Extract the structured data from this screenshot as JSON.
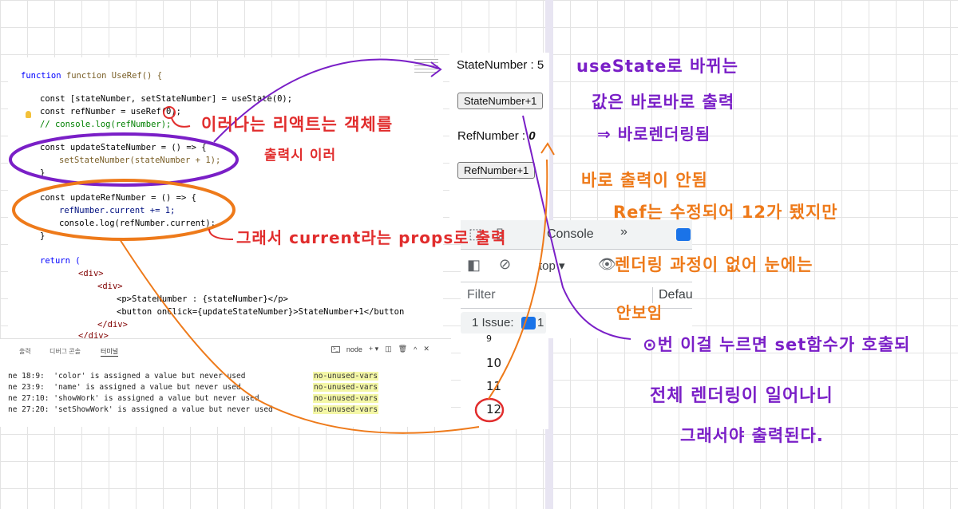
{
  "code": {
    "lines": [
      "function UseRef() {",
      "const [stateNumber, setStateNumber] = useState(0);",
      "const refNumber = useRef(0);",
      "// console.log(refNumber);",
      "const updateStateNumber = () => {",
      "setStateNumber(stateNumber + 1);",
      "}",
      "const updateRefNumber = () => {",
      "refNumber.current += 1;",
      "console.log(refNumber.current);",
      "}",
      "return (",
      "<div>",
      "<div>",
      "<p>StateNumber : {stateNumber}</p>",
      "<button onClick={updateStateNumber}>StateNumber+1</button",
      "</div>",
      "</div>"
    ]
  },
  "terminal": {
    "tabs": [
      "출력",
      "디버그 콘솔",
      "터미널"
    ],
    "active_tab": "터미널",
    "shell": "node",
    "lint_lines": [
      {
        "loc": "ne 18:9:",
        "msg": "'color' is assigned a value but never used",
        "rule": "no-unused-vars"
      },
      {
        "loc": "ne 23:9:",
        "msg": "'name' is assigned a value but never used",
        "rule": "no-unused-vars"
      },
      {
        "loc": "ne 27:10:",
        "msg": "'showWork' is assigned a value but never used",
        "rule": "no-unused-vars"
      },
      {
        "loc": "ne 27:20:",
        "msg": "'setShowWork' is assigned a value but never used",
        "rule": "no-unused-vars"
      }
    ]
  },
  "preview": {
    "state_label": "StateNumber : 5",
    "state_button": "StateNumber+1",
    "ref_label": "RefNumber : ",
    "ref_value": "0",
    "ref_button": "RefNumber+1"
  },
  "devtools": {
    "tab_console": "Console",
    "more_tabs": "»",
    "context": "top",
    "filter_placeholder": "Filter",
    "levels": "Defau",
    "issues_label": "1 Issue:",
    "issues_count": "1"
  },
  "console_output": [
    "9",
    "10",
    "11",
    "12"
  ],
  "annotations": {
    "red_1": "이러나는 리액트는 객체를",
    "red_2": "출력시 이러",
    "red_3": "그래서  current라는 props로 출력",
    "orange_1": "바로 출력이 안됨",
    "orange_2": "Ref는 수정되어 12가 됐지만",
    "orange_3": "렌더링 과정이 없어 눈에는",
    "orange_4": "안보임",
    "purple_1": "useState로 바뀌는",
    "purple_2": "값은 바로바로 출력",
    "purple_3": "⇒ 바로렌더링됨",
    "purple_4": "⊙번 이걸 누르면 set함수가 호출되",
    "purple_5": "전체 렌더링이 일어나니",
    "purple_6": "그래서야 출력된다."
  },
  "colors": {
    "red": "#e12d2d",
    "purple": "#7a1fc7",
    "orange": "#ee7a1a",
    "lint_highlight": "#f4f7a6"
  }
}
